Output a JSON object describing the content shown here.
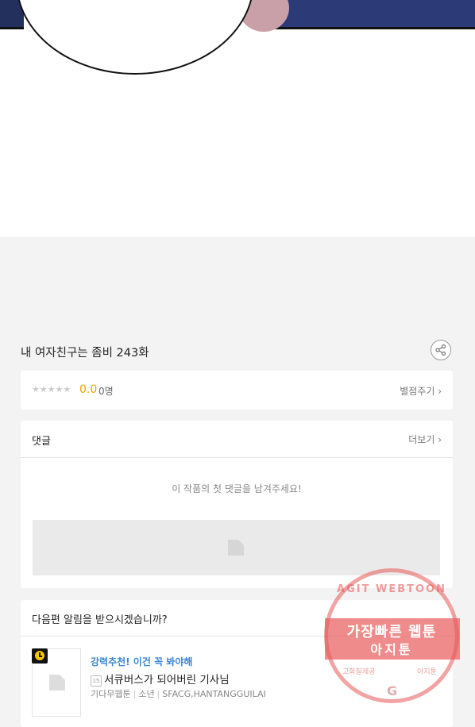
{
  "episode": {
    "title": "내 여자친구는 좀비 243화"
  },
  "rating": {
    "stars": "★★★★★",
    "score": "0.0",
    "count": "0명",
    "rate_label": "별점주기 ›"
  },
  "comments": {
    "label": "댓글",
    "more_label": "더보기 ›",
    "empty_text": "이 작품의 첫 댓글을 남겨주세요!"
  },
  "notify": {
    "label": "다음편 알림을 받으시겠습니까?",
    "promo": "강력추천! 이건 꼭 봐야해",
    "age_badge": "15",
    "work_title": "서큐버스가 되어버린 기사님",
    "meta": [
      "기다무웹툰",
      "소년",
      "SFACG,HANTANGGUILAI"
    ]
  },
  "watermark": {
    "arc": "AGIT WEBTOON",
    "line1": "가장빠른 웹툰",
    "line2": "아지툰",
    "left": "고화질제공",
    "right": "아지툰",
    "g": "G"
  },
  "colors": {
    "score": "#f0a000",
    "promo": "#3a86d8",
    "badge": "#f6c400"
  }
}
